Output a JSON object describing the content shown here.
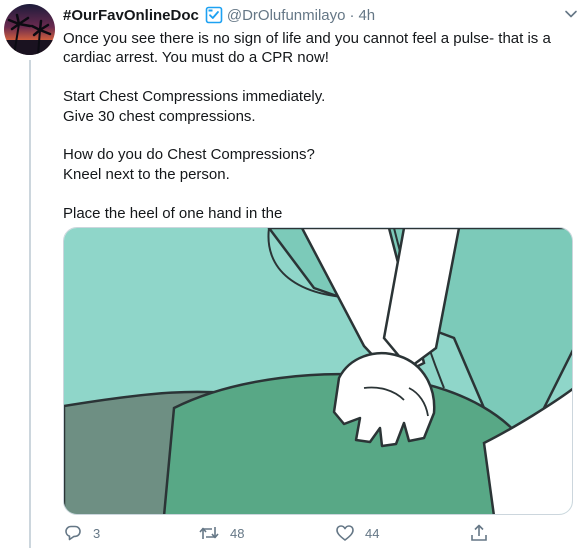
{
  "tweet": {
    "display_name": "#OurFavOnlineDoc",
    "handle": "@DrOlufunmilayo",
    "separator": "·",
    "time": "4h",
    "paragraphs": [
      [
        "Once you see there is no sign of life and you cannot feel a pulse- that is a",
        "cardiac arrest. You must do a CPR now!"
      ],
      [
        "Start Chest Compressions immediately.",
        "Give 30 chest compressions."
      ],
      [
        "How do you do Chest Compressions?",
        "Kneel next to the person."
      ],
      [
        "Place the heel of one hand in the"
      ]
    ]
  },
  "actions": {
    "replies": "3",
    "retweets": "48",
    "likes": "44"
  },
  "icons": {
    "verified": "verified-badge-icon",
    "more": "chevron-down-icon",
    "reply": "reply-icon",
    "retweet": "retweet-icon",
    "like": "heart-icon",
    "share": "share-icon"
  },
  "colors": {
    "secondary_text": "#657786",
    "verified_badge": "#1da1f2",
    "illustration_background": "#8fd6c9",
    "illustration_body": "#57a684"
  }
}
